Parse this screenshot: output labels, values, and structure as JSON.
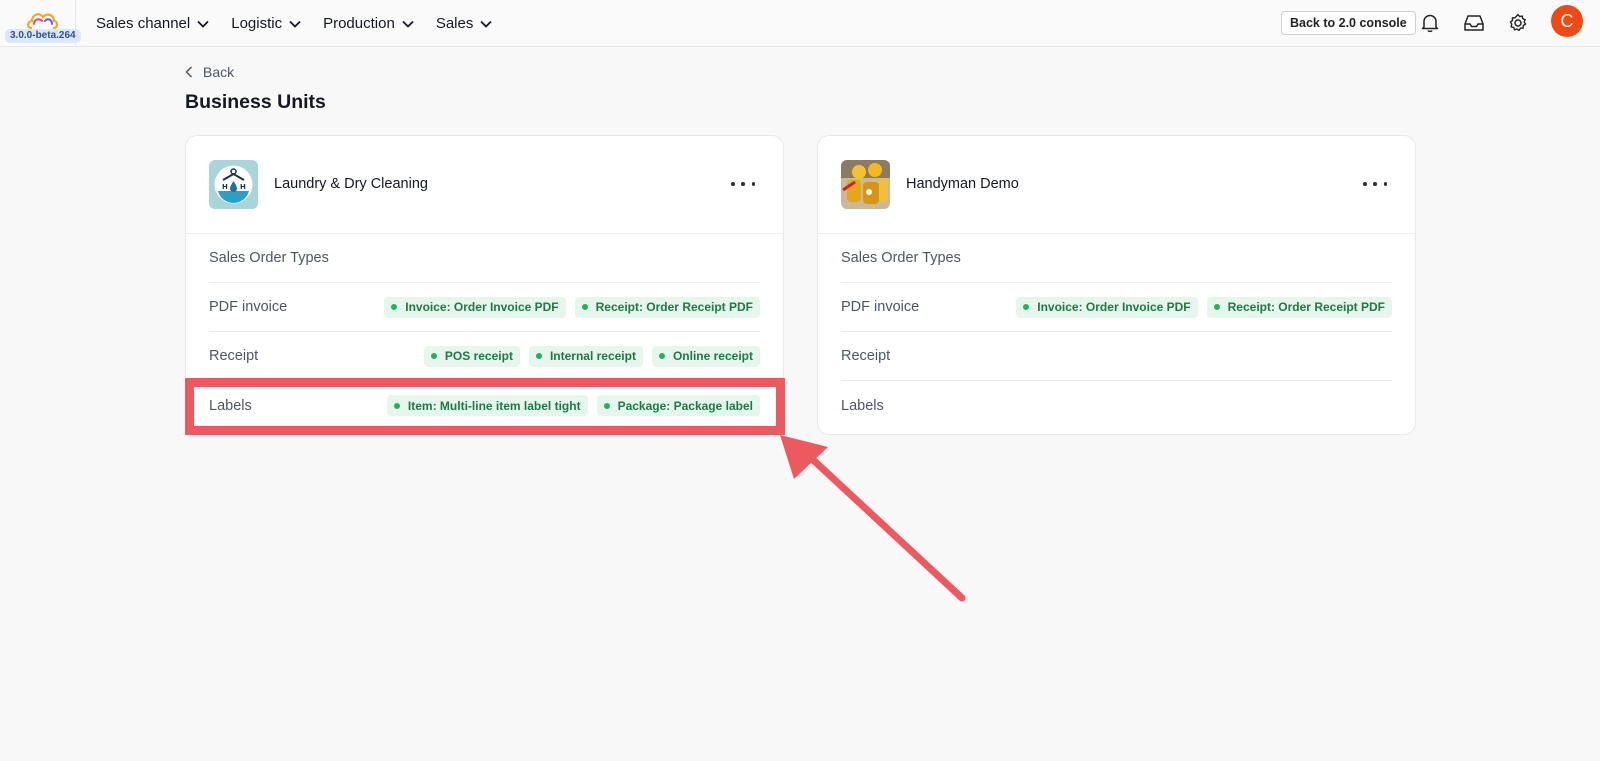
{
  "app": {
    "version": "3.0.0-beta.264",
    "nav": [
      {
        "label": "Sales channel"
      },
      {
        "label": "Logistic"
      },
      {
        "label": "Production"
      },
      {
        "label": "Sales"
      }
    ],
    "console_button": "Back to 2.0 console",
    "avatar_initial": "C",
    "icons": [
      "bell-icon",
      "inbox-icon",
      "gear-icon"
    ]
  },
  "page": {
    "back_label": "Back",
    "title": "Business Units"
  },
  "units": [
    {
      "name": "Laundry & Dry Cleaning",
      "rows": [
        {
          "label": "Sales Order Types",
          "tags": []
        },
        {
          "label": "PDF invoice",
          "tags": [
            "Invoice: Order Invoice PDF",
            "Receipt: Order Receipt PDF"
          ]
        },
        {
          "label": "Receipt",
          "tags": [
            "POS receipt",
            "Internal receipt",
            "Online receipt"
          ]
        },
        {
          "label": "Labels",
          "tags": [
            "Item: Multi-line item label tight",
            "Package: Package label"
          ]
        }
      ]
    },
    {
      "name": "Handyman Demo",
      "rows": [
        {
          "label": "Sales Order Types",
          "tags": []
        },
        {
          "label": "PDF invoice",
          "tags": [
            "Invoice: Order Invoice PDF",
            "Receipt: Order Receipt PDF"
          ]
        },
        {
          "label": "Receipt",
          "tags": []
        },
        {
          "label": "Labels",
          "tags": []
        }
      ]
    }
  ],
  "colors": {
    "tag_bg": "#e6f6ec",
    "tag_text": "#1d7a44",
    "tag_dot": "#20b45a",
    "annotation": "#ec5a5f",
    "avatar": "#f04a14"
  }
}
